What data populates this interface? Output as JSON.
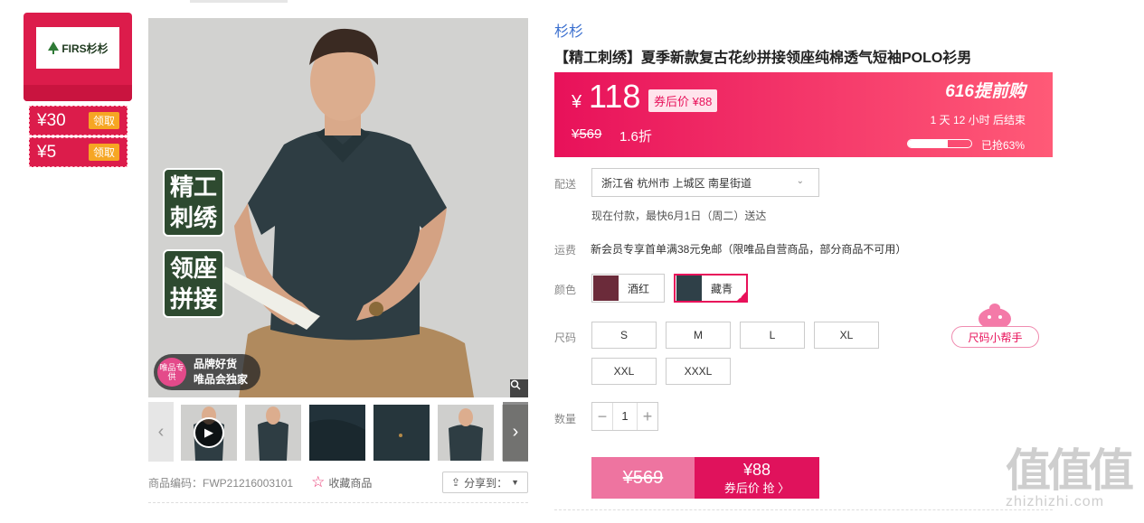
{
  "brand_card": {
    "logo_text": "FIRS杉杉"
  },
  "coupons": [
    {
      "amount": "¥30",
      "action": "领取"
    },
    {
      "amount": "¥5",
      "action": "领取"
    }
  ],
  "main_image": {
    "tag1": [
      "精工",
      "刺绣"
    ],
    "tag2": [
      "领座",
      "拼接"
    ],
    "vip_badge": {
      "circle": "唯品专供",
      "line1": "品牌好货",
      "line2": "唯品会独家"
    }
  },
  "meta": {
    "product_code": "商品编码：FWP21216003101",
    "favorite": "收藏商品",
    "share": "分享到："
  },
  "product": {
    "brand": "杉杉",
    "title": "【精工刺绣】夏季新款复古花纱拼接领座纯棉透气短袖POLO衫男"
  },
  "price_panel": {
    "currency": "¥",
    "price": "118",
    "after_coupon": "券后价 ¥88",
    "original": "¥569",
    "discount": "1.6折",
    "promo": "616提前购",
    "countdown": "1 天 12 小时 后结束",
    "sold_label": "已抢63%",
    "sold_fraction": 0.63
  },
  "delivery": {
    "label": "配送",
    "address": "浙江省 杭州市 上城区 南星街道",
    "note": "现在付款，最快6月1日（周二）送达"
  },
  "shipping": {
    "label": "运费",
    "text": "新会员专享首单满38元免邮（限唯品自营商品，部分商品不可用）"
  },
  "colors": {
    "label": "颜色",
    "options": [
      {
        "name": "酒红",
        "swatch": "#6b2b3a"
      },
      {
        "name": "藏青",
        "swatch": "#2f4048"
      }
    ],
    "selected": "藏青"
  },
  "sizes": {
    "label": "尺码",
    "options": [
      "S",
      "M",
      "L",
      "XL",
      "XXL",
      "XXXL"
    ],
    "helper": "尺码小帮手"
  },
  "quantity": {
    "label": "数量",
    "value": "1",
    "minus": "−",
    "plus": "+"
  },
  "buy_bar": {
    "original": "¥569",
    "price": "¥88",
    "label": "券后价 抢 〉"
  },
  "watermark": {
    "big": "值值值",
    "small": "zhizhizhi.com"
  },
  "colors_theme": {
    "accent": "#e8115a",
    "brand_red": "#dc1c4b",
    "link_blue": "#3a6fcf"
  }
}
